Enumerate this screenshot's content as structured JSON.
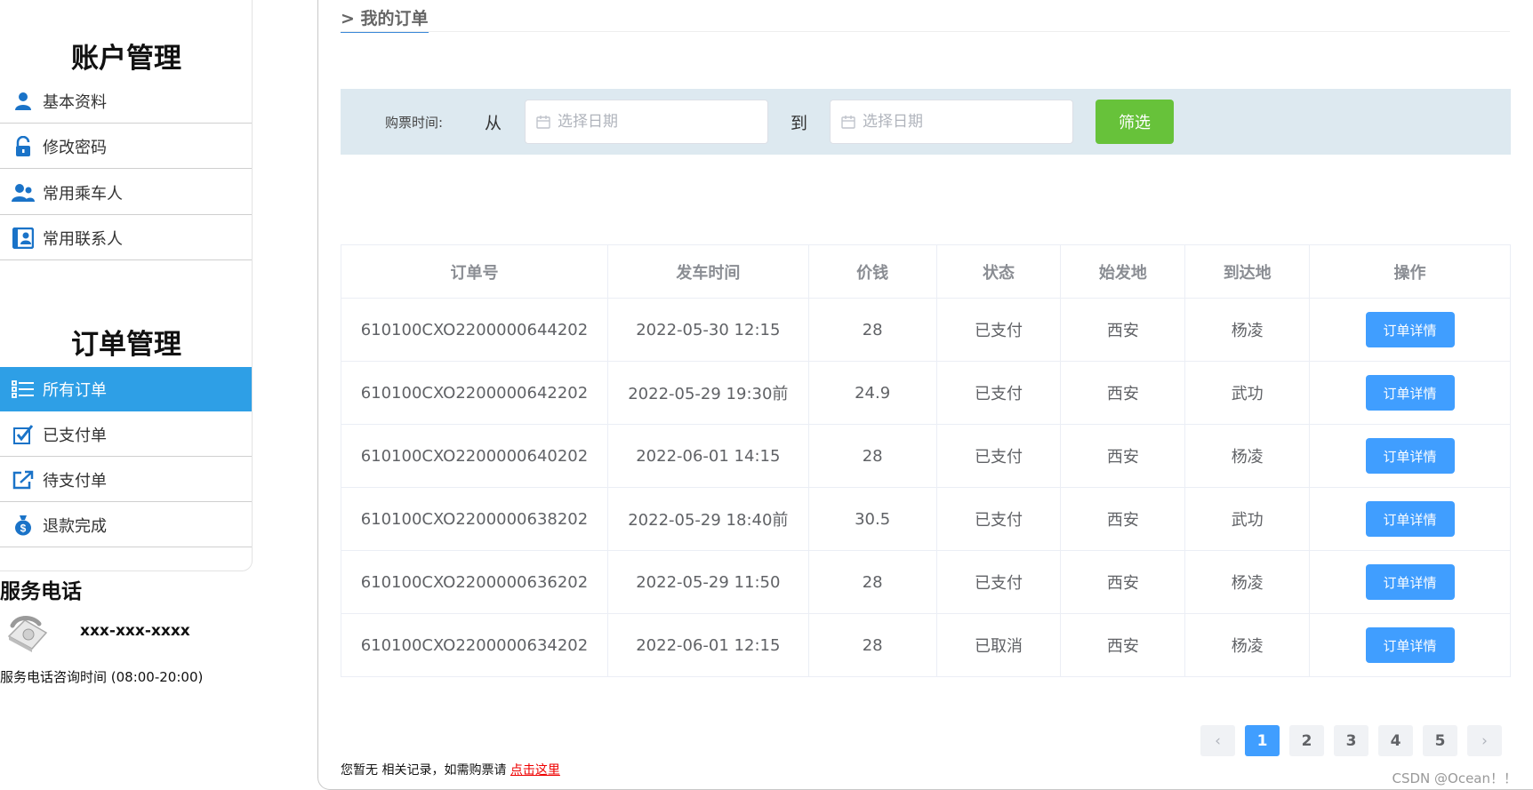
{
  "sidebar": {
    "account_title": "账户管理",
    "account_items": [
      {
        "label": "基本资料",
        "icon": "user-icon"
      },
      {
        "label": "修改密码",
        "icon": "lock-icon"
      },
      {
        "label": "常用乘车人",
        "icon": "users-icon"
      },
      {
        "label": "常用联系人",
        "icon": "contacts-icon"
      }
    ],
    "order_title": "订单管理",
    "order_items": [
      {
        "label": "所有订单",
        "icon": "list-icon",
        "active": true
      },
      {
        "label": "已支付单",
        "icon": "checked-icon"
      },
      {
        "label": "待支付单",
        "icon": "share-icon"
      },
      {
        "label": "退款完成",
        "icon": "money-bag-icon"
      }
    ],
    "service_title": "服务电话",
    "service_phone": "xxx-xxx-xxxx",
    "service_hours": "服务电话咨询时间 (08:00-20:00)"
  },
  "main": {
    "breadcrumb": "> 我的订单",
    "filter": {
      "label": "购票时间:",
      "from": "从",
      "to": "到",
      "start_placeholder": "选择日期",
      "end_placeholder": "选择日期",
      "button": "筛选"
    },
    "table": {
      "headers": [
        "订单号",
        "发车时间",
        "价钱",
        "状态",
        "始发地",
        "到达地",
        "操作"
      ],
      "rows": [
        {
          "order_no": "610100CXO2200000644202",
          "time": "2022-05-30 12:15",
          "price": "28",
          "status": "已支付",
          "from": "西安",
          "to": "杨凌",
          "action": "订单详情"
        },
        {
          "order_no": "610100CXO2200000642202",
          "time": "2022-05-29 19:30前",
          "price": "24.9",
          "status": "已支付",
          "from": "西安",
          "to": "武功",
          "action": "订单详情"
        },
        {
          "order_no": "610100CXO2200000640202",
          "time": "2022-06-01 14:15",
          "price": "28",
          "status": "已支付",
          "from": "西安",
          "to": "杨凌",
          "action": "订单详情"
        },
        {
          "order_no": "610100CXO2200000638202",
          "time": "2022-05-29 18:40前",
          "price": "30.5",
          "status": "已支付",
          "from": "西安",
          "to": "武功",
          "action": "订单详情"
        },
        {
          "order_no": "610100CXO2200000636202",
          "time": "2022-05-29 11:50",
          "price": "28",
          "status": "已支付",
          "from": "西安",
          "to": "杨凌",
          "action": "订单详情"
        },
        {
          "order_no": "610100CXO2200000634202",
          "time": "2022-06-01 12:15",
          "price": "28",
          "status": "已取消",
          "from": "西安",
          "to": "杨凌",
          "action": "订单详情"
        }
      ]
    },
    "pagination": {
      "prev": "‹",
      "pages": [
        "1",
        "2",
        "3",
        "4",
        "5"
      ],
      "current": "1",
      "next": "›"
    },
    "notice": {
      "text": "您暂无 相关记录，如需购票请 ",
      "link": "点击这里"
    }
  },
  "watermark": "CSDN @Ocean！！",
  "colors": {
    "active_sidebar": "#2e9fe6",
    "filter_bg": "#dde9f0",
    "filter_button": "#67c23a",
    "primary": "#409eff",
    "link": "#ee0000"
  }
}
